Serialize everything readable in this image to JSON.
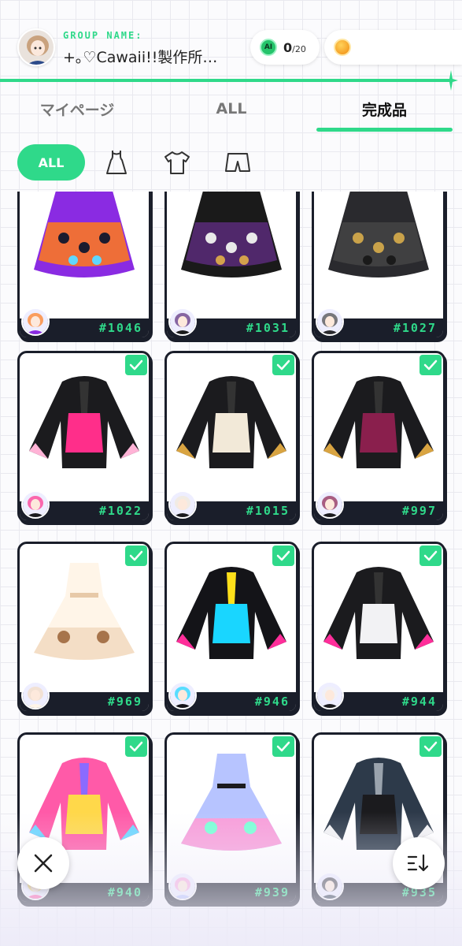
{
  "header": {
    "group_label": "GROUP NAME:",
    "group_name": "+｡♡Cawaii!!製作所…",
    "ai_count": "0",
    "ai_total": "/20",
    "ai_badge": "AI"
  },
  "tabs": [
    {
      "label": "マイページ",
      "active": false
    },
    {
      "label": "ALL",
      "active": false
    },
    {
      "label": "完成品",
      "active": true
    }
  ],
  "filters": {
    "all_label": "ALL",
    "icons": [
      "dress-icon",
      "shirt-icon",
      "shorts-icon"
    ]
  },
  "items": [
    {
      "number": "#1046",
      "checked": false,
      "palette": [
        "#8a2be2",
        "#ff7a1a",
        "#1b1b2e",
        "#5fd6ff"
      ]
    },
    {
      "number": "#1031",
      "checked": false,
      "palette": [
        "#1a1a1a",
        "#5a2b7a",
        "#e9e9e9",
        "#d4a24c"
      ]
    },
    {
      "number": "#1027",
      "checked": false,
      "palette": [
        "#2a2a2e",
        "#444",
        "#c9a24a",
        "#1a1a1a"
      ]
    },
    {
      "number": "#1022",
      "checked": true,
      "palette": [
        "#1b1b1e",
        "#ff2e8a",
        "#ffb3d6",
        "#333"
      ]
    },
    {
      "number": "#1015",
      "checked": true,
      "palette": [
        "#1b1b1e",
        "#f2e9d8",
        "#d9a441",
        "#333"
      ]
    },
    {
      "number": "#997",
      "checked": true,
      "palette": [
        "#1b1b1e",
        "#8a1f4d",
        "#d9a441",
        "#333"
      ]
    },
    {
      "number": "#969",
      "checked": true,
      "palette": [
        "#fff5e8",
        "#f3dcc2",
        "#a7744b",
        "#e7c9a8"
      ]
    },
    {
      "number": "#946",
      "checked": true,
      "palette": [
        "#141418",
        "#19d6ff",
        "#ff2e9a",
        "#ffe01a"
      ]
    },
    {
      "number": "#944",
      "checked": true,
      "palette": [
        "#1b1b1e",
        "#f2f2f4",
        "#ff2e9a",
        "#333"
      ]
    },
    {
      "number": "#940",
      "checked": true,
      "palette": [
        "#ff5aa8",
        "#ffd84a",
        "#6ad6ff",
        "#8a6bff"
      ]
    },
    {
      "number": "#939",
      "checked": true,
      "palette": [
        "#b7c4ff",
        "#ff9ad6",
        "#7affd6",
        "#1b1b1e"
      ]
    },
    {
      "number": "#935",
      "checked": true,
      "palette": [
        "#2d3a4a",
        "#1b1b1e",
        "#f2f2f4",
        "#9aa3ad"
      ]
    }
  ],
  "colors": {
    "accent": "#2fd98a",
    "card_border": "#1a1e2a"
  },
  "icons": {
    "close": "close-icon",
    "sort": "sort-icon"
  }
}
